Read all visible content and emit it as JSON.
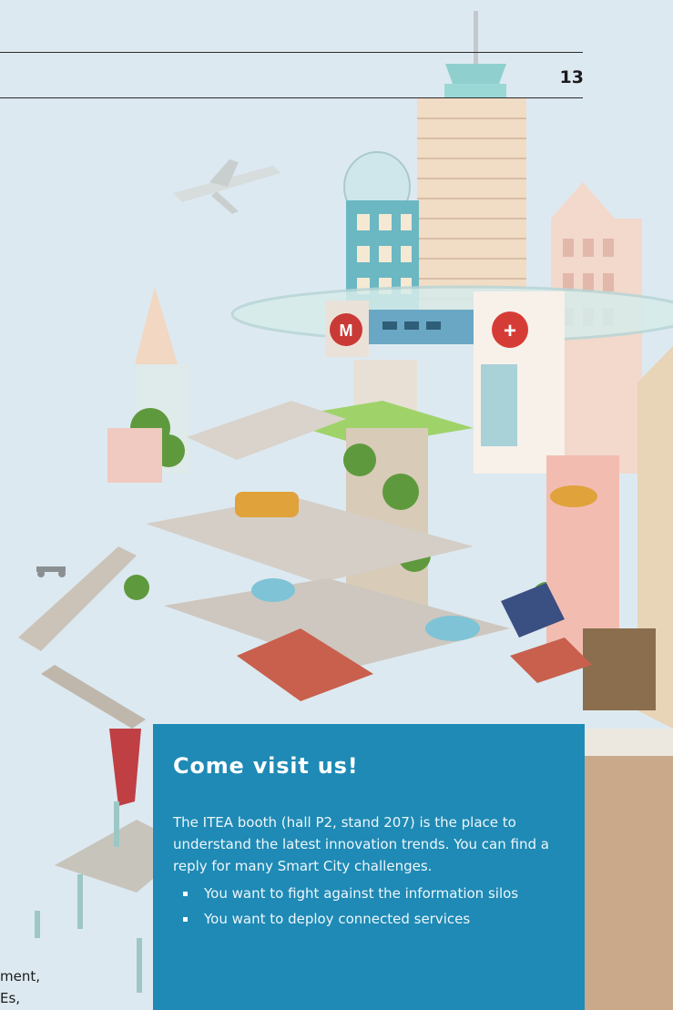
{
  "page": {
    "number": "13"
  },
  "illustration": {
    "signs": {
      "metro_letter": "M",
      "hospital_symbol": "+"
    }
  },
  "callout": {
    "title": "Come visit us!",
    "body": "The ITEA booth (hall P2, stand 207) is the place to understand the latest innovation trends. You can find a reply for many Smart City challenges.",
    "bullets": [
      "You want to fight against the information silos",
      "You want to deploy connected services"
    ]
  },
  "cropped_text": {
    "lines": [
      "ment,",
      "Es,"
    ]
  },
  "colors": {
    "background": "#dde9f1",
    "callout_bg": "#1e8ab5",
    "text_dark": "#1b1b1b",
    "metro_sign": "#c93a36",
    "hospital_sign": "#d63c36"
  }
}
